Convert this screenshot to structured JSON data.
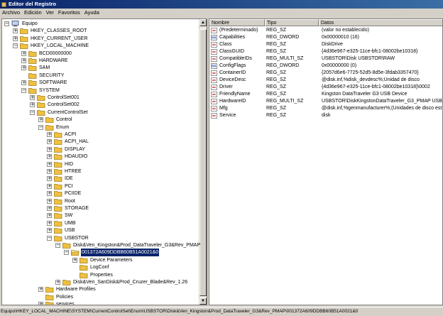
{
  "window": {
    "title": "Editor del Registro"
  },
  "menu": [
    "Archivo",
    "Edición",
    "Ver",
    "Favoritos",
    "Ayuda"
  ],
  "tree": [
    {
      "label": "Equipo",
      "level": 0,
      "expander": "minus",
      "icon": "computer"
    },
    {
      "label": "HKEY_CLASSES_ROOT",
      "level": 1,
      "expander": "plus",
      "icon": "folder"
    },
    {
      "label": "HKEY_CURRENT_USER",
      "level": 1,
      "expander": "plus",
      "icon": "folder"
    },
    {
      "label": "HKEY_LOCAL_MACHINE",
      "level": 1,
      "expander": "minus",
      "icon": "folder"
    },
    {
      "label": "BCD00000000",
      "level": 2,
      "expander": "plus",
      "icon": "folder"
    },
    {
      "label": "HARDWARE",
      "level": 2,
      "expander": "plus",
      "icon": "folder"
    },
    {
      "label": "SAM",
      "level": 2,
      "expander": "plus",
      "icon": "folder"
    },
    {
      "label": "SECURITY",
      "level": 2,
      "expander": "none",
      "icon": "folder"
    },
    {
      "label": "SOFTWARE",
      "level": 2,
      "expander": "plus",
      "icon": "folder"
    },
    {
      "label": "SYSTEM",
      "level": 2,
      "expander": "minus",
      "icon": "folder"
    },
    {
      "label": "ControlSet001",
      "level": 3,
      "expander": "plus",
      "icon": "folder"
    },
    {
      "label": "ControlSet002",
      "level": 3,
      "expander": "plus",
      "icon": "folder"
    },
    {
      "label": "CurrentControlSet",
      "level": 3,
      "expander": "minus",
      "icon": "folder"
    },
    {
      "label": "Control",
      "level": 4,
      "expander": "plus",
      "icon": "folder"
    },
    {
      "label": "Enum",
      "level": 4,
      "expander": "minus",
      "icon": "folder"
    },
    {
      "label": "ACPI",
      "level": 5,
      "expander": "plus",
      "icon": "folder"
    },
    {
      "label": "ACPI_HAL",
      "level": 5,
      "expander": "plus",
      "icon": "folder"
    },
    {
      "label": "DISPLAY",
      "level": 5,
      "expander": "plus",
      "icon": "folder"
    },
    {
      "label": "HDAUDIO",
      "level": 5,
      "expander": "plus",
      "icon": "folder"
    },
    {
      "label": "HID",
      "level": 5,
      "expander": "plus",
      "icon": "folder"
    },
    {
      "label": "HTREE",
      "level": 5,
      "expander": "plus",
      "icon": "folder"
    },
    {
      "label": "IDE",
      "level": 5,
      "expander": "plus",
      "icon": "folder"
    },
    {
      "label": "PCI",
      "level": 5,
      "expander": "plus",
      "icon": "folder"
    },
    {
      "label": "PCIIDE",
      "level": 5,
      "expander": "plus",
      "icon": "folder"
    },
    {
      "label": "Root",
      "level": 5,
      "expander": "plus",
      "icon": "folder"
    },
    {
      "label": "STORAGE",
      "level": 5,
      "expander": "plus",
      "icon": "folder"
    },
    {
      "label": "SW",
      "level": 5,
      "expander": "plus",
      "icon": "folder"
    },
    {
      "label": "UMB",
      "level": 5,
      "expander": "plus",
      "icon": "folder"
    },
    {
      "label": "USB",
      "level": 5,
      "expander": "plus",
      "icon": "folder"
    },
    {
      "label": "USBSTOR",
      "level": 5,
      "expander": "minus",
      "icon": "folder"
    },
    {
      "label": "Disk&Ven_Kingston&Prod_DataTraveler_G3&Rev_PMAP",
      "level": 6,
      "expander": "minus",
      "icon": "folder"
    },
    {
      "label": "001372A609DDBB60B51A0021&0",
      "level": 7,
      "expander": "minus",
      "icon": "folder-open",
      "selected": true
    },
    {
      "label": "Device Parameters",
      "level": 8,
      "expander": "plus",
      "icon": "folder"
    },
    {
      "label": "LogConf",
      "level": 8,
      "expander": "none",
      "icon": "folder"
    },
    {
      "label": "Properties",
      "level": 8,
      "expander": "none",
      "icon": "folder"
    },
    {
      "label": "Disk&Ven_SanDisk&Prod_Cruzer_Blade&Rev_1.26",
      "level": 6,
      "expander": "plus",
      "icon": "folder"
    },
    {
      "label": "Hardware Profiles",
      "level": 4,
      "expander": "plus",
      "icon": "folder"
    },
    {
      "label": "Policies",
      "level": 4,
      "expander": "none",
      "icon": "folder"
    },
    {
      "label": "services",
      "level": 4,
      "expander": "plus",
      "icon": "folder"
    }
  ],
  "list": {
    "columns": [
      "Nombre",
      "Tipo",
      "Datos"
    ],
    "rows": [
      {
        "icon": "ab",
        "name": "(Predeterminado)",
        "type": "REG_SZ",
        "data": "(valor no establecido)"
      },
      {
        "icon": "bin",
        "name": "Capabilities",
        "type": "REG_DWORD",
        "data": "0x00000010 (16)"
      },
      {
        "icon": "ab",
        "name": "Class",
        "type": "REG_SZ",
        "data": "DiskDrive"
      },
      {
        "icon": "ab",
        "name": "ClassGUID",
        "type": "REG_SZ",
        "data": "{4d36e967-e325-11ce-bfc1-08002be10318}"
      },
      {
        "icon": "ab",
        "name": "CompatibleIDs",
        "type": "REG_MULTI_SZ",
        "data": "USBSTOR\\Disk USBSTOR\\RAW"
      },
      {
        "icon": "bin",
        "name": "ConfigFlags",
        "type": "REG_DWORD",
        "data": "0x00000000 (0)"
      },
      {
        "icon": "ab",
        "name": "ContainerID",
        "type": "REG_SZ",
        "data": "{2057d6e6-7725-52d5-8d5e-3fdab3357470}"
      },
      {
        "icon": "ab",
        "name": "DeviceDesc",
        "type": "REG_SZ",
        "data": "@disk.inf,%disk_devdesc%;Unidad de disco"
      },
      {
        "icon": "ab",
        "name": "Driver",
        "type": "REG_SZ",
        "data": "{4d36e967-e325-11ce-bfc1-08002be10318}\\0002"
      },
      {
        "icon": "ab",
        "name": "FriendlyName",
        "type": "REG_SZ",
        "data": "Kingston DataTraveler G3 USB Device"
      },
      {
        "icon": "ab",
        "name": "HardwareID",
        "type": "REG_MULTI_SZ",
        "data": "USBSTOR\\DiskKingstonDataTraveler_G3_PMAP USBST..."
      },
      {
        "icon": "ab",
        "name": "Mfg",
        "type": "REG_SZ",
        "data": "@disk.inf,%genmanufacturer%;(Unidades de disco est"
      },
      {
        "icon": "ab",
        "name": "Service",
        "type": "REG_SZ",
        "data": "disk"
      }
    ]
  },
  "status": "Equipo\\HKEY_LOCAL_MACHINE\\SYSTEM\\CurrentControlSet\\Enum\\USBSTOR\\Disk&Ven_Kingston&Prod_DataTraveler_G3&Rev_PMAP\\001372A609DDBB60B51A0021&0",
  "colors": {
    "title_start": "#0a246a",
    "selection": "#0a246a",
    "folder": "#f0c040"
  }
}
